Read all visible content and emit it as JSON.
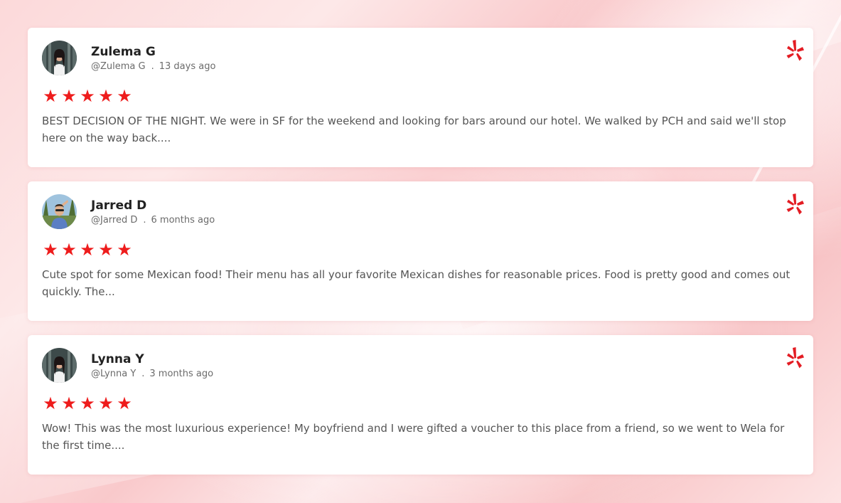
{
  "colors": {
    "star": "#ee1c1c",
    "yelp": "#e31c23",
    "name": "#222222",
    "meta": "#6b6b6b",
    "body_text": "#555555"
  },
  "reviews": [
    {
      "name": "Zulema G",
      "handle": "@Zulema G",
      "separator": ".",
      "time_ago": "13 days ago",
      "rating": 5,
      "stars": [
        "★",
        "★",
        "★",
        "★",
        "★"
      ],
      "text": "BEST DECISION OF THE NIGHT. We were in SF for the weekend and looking for bars around our hotel. We walked by PCH and said we'll stop here on the way back....",
      "source_icon": "yelp-icon"
    },
    {
      "name": "Jarred D",
      "handle": "@Jarred D",
      "separator": ".",
      "time_ago": "6 months ago",
      "rating": 5,
      "stars": [
        "★",
        "★",
        "★",
        "★",
        "★"
      ],
      "text": "Cute spot for some Mexican food! Their menu has all your favorite Mexican dishes for reasonable prices. Food is pretty good and comes out quickly. The...",
      "source_icon": "yelp-icon"
    },
    {
      "name": "Lynna Y",
      "handle": "@Lynna Y",
      "separator": ".",
      "time_ago": "3 months ago",
      "rating": 5,
      "stars": [
        "★",
        "★",
        "★",
        "★",
        "★"
      ],
      "text": "Wow! This was the most luxurious experience! My boyfriend and I were gifted a voucher to this place from a friend, so we went to Wela for the first time....",
      "source_icon": "yelp-icon"
    }
  ]
}
